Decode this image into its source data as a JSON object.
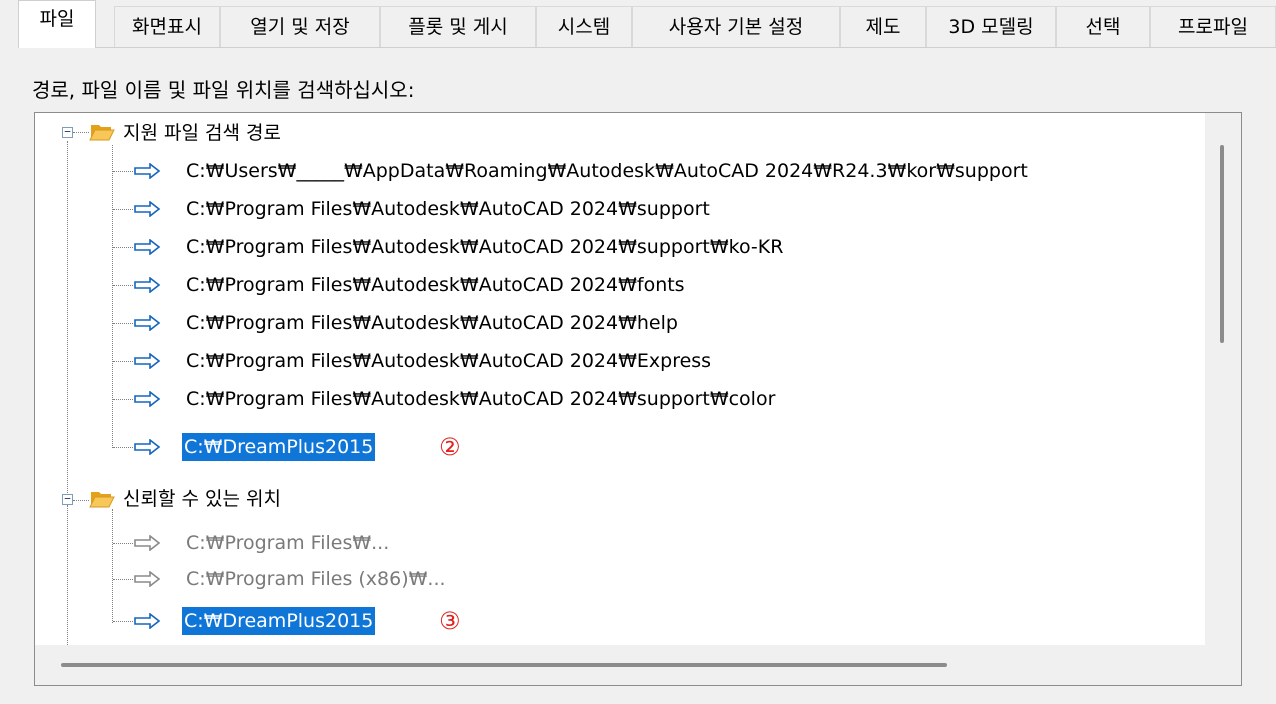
{
  "tabs": [
    "파일",
    "화면표시",
    "열기 및 저장",
    "플롯 및 게시",
    "시스템",
    "사용자 기본 설정",
    "제도",
    "3D 모델링",
    "선택",
    "프로파일"
  ],
  "active_tab": "파일",
  "prompt": "경로, 파일 이름 및 파일 위치를 검색하십시오:",
  "tree": {
    "support_group": {
      "label": "지원 파일 검색 경로",
      "items": [
        "C:₩Users₩_____₩AppData₩Roaming₩Autodesk₩AutoCAD 2024₩R24.3₩kor₩support",
        "C:₩Program Files₩Autodesk₩AutoCAD 2024₩support",
        "C:₩Program Files₩Autodesk₩AutoCAD 2024₩support₩ko-KR",
        "C:₩Program Files₩Autodesk₩AutoCAD 2024₩fonts",
        "C:₩Program Files₩Autodesk₩AutoCAD 2024₩help",
        "C:₩Program Files₩Autodesk₩AutoCAD 2024₩Express",
        "C:₩Program Files₩Autodesk₩AutoCAD 2024₩support₩color",
        "C:₩DreamPlus2015"
      ],
      "annotation": "②"
    },
    "trusted_group": {
      "label": "신뢰할 수 있는 위치",
      "items": [
        "C:₩Program Files₩...",
        "C:₩Program Files (x86)₩...",
        "C:₩DreamPlus2015"
      ],
      "annotation": "③"
    }
  },
  "colors": {
    "selection": "#0f76d8",
    "annotation": "#e0211c",
    "arrow": "#1565c0",
    "folder": "#f2b53a"
  }
}
